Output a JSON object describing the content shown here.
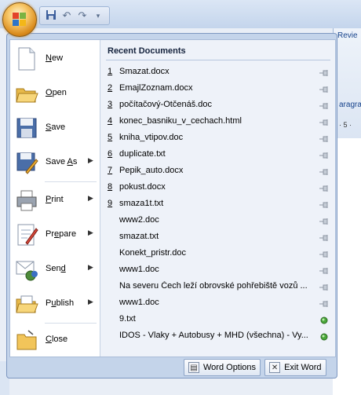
{
  "background": {
    "ribbon_tab_partial": "Revie",
    "ribbon_group_partial": "aragra",
    "ruler_mark": "· 5 ·"
  },
  "quick_access": {
    "save_icon": "save-icon",
    "undo_icon": "undo-icon",
    "redo_icon": "redo-icon",
    "customize_icon": "customize-qat-icon"
  },
  "menu": {
    "commands": [
      {
        "label": "New",
        "accel": "N",
        "icon": "new-document-icon",
        "submenu": false
      },
      {
        "label": "Open",
        "accel": "O",
        "icon": "open-folder-icon",
        "submenu": false
      },
      {
        "label": "Save",
        "accel": "S",
        "icon": "save-disk-icon",
        "submenu": false
      },
      {
        "label": "Save As",
        "accel": "A",
        "icon": "save-as-icon",
        "submenu": true
      },
      {
        "label": "Print",
        "accel": "P",
        "icon": "printer-icon",
        "submenu": true
      },
      {
        "label": "Prepare",
        "accel": "E",
        "icon": "prepare-icon",
        "submenu": true
      },
      {
        "label": "Send",
        "accel": "D",
        "icon": "send-icon",
        "submenu": true
      },
      {
        "label": "Publish",
        "accel": "U",
        "icon": "publish-icon",
        "submenu": true
      },
      {
        "label": "Close",
        "accel": "C",
        "icon": "close-folder-icon",
        "submenu": false
      }
    ],
    "recent_title": "Recent Documents",
    "recent": [
      {
        "num": "1",
        "name": "Smazat.docx",
        "pinned": false
      },
      {
        "num": "2",
        "name": "EmajlZoznam.docx",
        "pinned": false
      },
      {
        "num": "3",
        "name": "počítačový-Otčenáš.doc",
        "pinned": false
      },
      {
        "num": "4",
        "name": "konec_basniku_v_cechach.html",
        "pinned": false
      },
      {
        "num": "5",
        "name": "kniha_vtipov.doc",
        "pinned": false
      },
      {
        "num": "6",
        "name": "duplicate.txt",
        "pinned": false
      },
      {
        "num": "7",
        "name": "Pepik_auto.docx",
        "pinned": false
      },
      {
        "num": "8",
        "name": "pokust.docx",
        "pinned": false
      },
      {
        "num": "9",
        "name": "smaza1t.txt",
        "pinned": false
      },
      {
        "num": "",
        "name": "www2.doc",
        "pinned": false
      },
      {
        "num": "",
        "name": "smazat.txt",
        "pinned": false
      },
      {
        "num": "",
        "name": "Konekt_pristr.doc",
        "pinned": false
      },
      {
        "num": "",
        "name": "www1.doc",
        "pinned": false
      },
      {
        "num": "",
        "name": "Na severu Čech leží obrovské pohřebiště vozů ...",
        "pinned": false
      },
      {
        "num": "",
        "name": "www1.doc",
        "pinned": false
      },
      {
        "num": "",
        "name": "9.txt",
        "pinned": true
      },
      {
        "num": "",
        "name": "IDOS - Vlaky + Autobusy + MHD (všechna) - Vy...",
        "pinned": true
      }
    ],
    "word_options_label": "Word Options",
    "exit_word_label": "Exit Word"
  }
}
